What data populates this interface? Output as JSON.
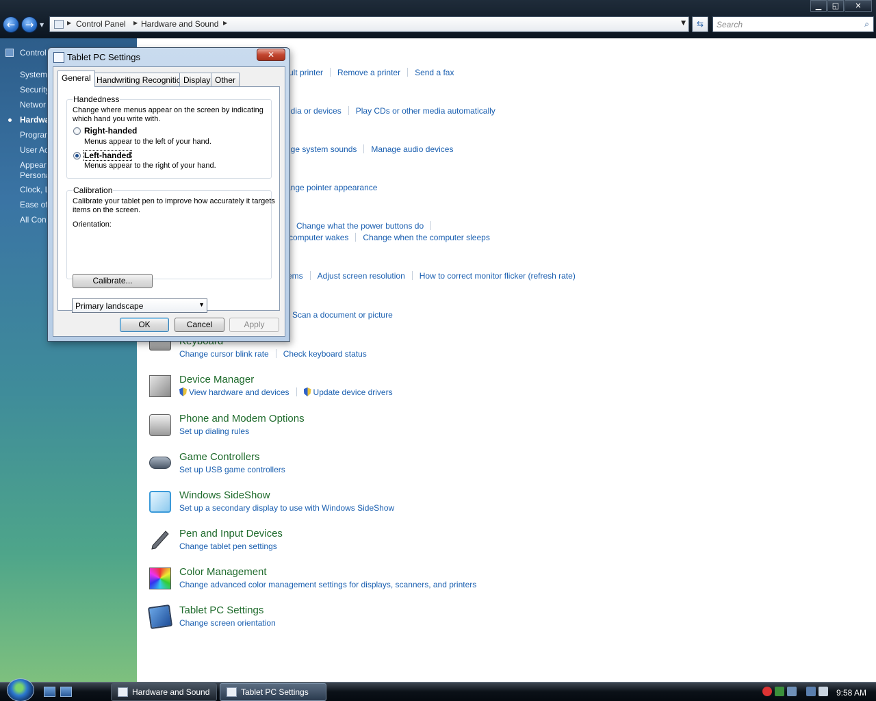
{
  "window": {
    "controls": {
      "minimize": "▁",
      "maximize": "◱",
      "close": "✕"
    },
    "back_glyph": "←",
    "forward_glyph": "→"
  },
  "address": {
    "crumbs": [
      "Control Panel",
      "Hardware and Sound"
    ],
    "search_placeholder": "Search"
  },
  "left_pane": {
    "items": [
      "Control",
      "System",
      "Security",
      "Networ",
      "Hardwa",
      "Program",
      "User Ac",
      "Appear",
      "Persona",
      "Clock, L",
      "Ease of",
      "All Con"
    ]
  },
  "content": {
    "partial_rows": [
      {
        "links": [
          "ult printer",
          "Remove a printer",
          "Send a fax"
        ]
      },
      {
        "links": [
          "edia or devices",
          "Play CDs or other media automatically"
        ]
      },
      {
        "links": [
          "nge system sounds",
          "Manage audio devices"
        ]
      },
      {
        "links": [
          "ange pointer appearance"
        ]
      },
      {
        "links": [
          "Change what the power buttons do"
        ]
      },
      {
        "links": [
          "computer wakes",
          "Change when the computer sleeps"
        ]
      },
      {
        "links": [
          "ems",
          "Adjust screen resolution",
          "How to correct monitor flicker (refresh rate)"
        ]
      },
      {
        "links": [
          "Scan a document or picture"
        ]
      }
    ],
    "categories": [
      {
        "title": "Keyboard",
        "links": [
          "Change cursor blink rate",
          "Check keyboard status"
        ]
      },
      {
        "title": "Device Manager",
        "links": [
          "View hardware and devices",
          "Update device drivers"
        ]
      },
      {
        "title": "Phone and Modem Options",
        "links": [
          "Set up dialing rules"
        ]
      },
      {
        "title": "Game Controllers",
        "links": [
          "Set up USB game controllers"
        ]
      },
      {
        "title": "Windows SideShow",
        "links": [
          "Set up a secondary display to use with Windows SideShow"
        ]
      },
      {
        "title": "Pen and Input Devices",
        "links": [
          "Change tablet pen settings"
        ]
      },
      {
        "title": "Color Management",
        "links": [
          "Change advanced color management settings for displays, scanners, and printers"
        ]
      },
      {
        "title": "Tablet PC Settings",
        "links": [
          "Change screen orientation"
        ]
      }
    ]
  },
  "dialog": {
    "title": "Tablet PC Settings",
    "close": "✕",
    "tabs": [
      "General",
      "Handwriting Recognition",
      "Display",
      "Other"
    ],
    "handedness": {
      "legend": "Handedness",
      "desc1": "Change where menus appear on the screen by indicating",
      "desc2": "which hand you write with.",
      "right_label": "Right-handed",
      "right_desc": "Menus appear to the left of your hand.",
      "left_label": "Left-handed",
      "left_desc": "Menus appear to the right of your hand.",
      "selected": "Left-handed"
    },
    "calibration": {
      "legend": "Calibration",
      "desc1": "Calibrate your tablet pen to improve how accurately it targets",
      "desc2": "items on the screen.",
      "orientation_label": "Orientation:",
      "orientation_value": "Primary landscape",
      "calibrate_button": "Calibrate..."
    },
    "buttons": {
      "ok": "OK",
      "cancel": "Cancel",
      "apply": "Apply"
    }
  },
  "taskbar": {
    "items": [
      "Hardware and Sound",
      "Tablet PC Settings"
    ],
    "active": "Tablet PC Settings",
    "clock": "9:58 AM"
  }
}
